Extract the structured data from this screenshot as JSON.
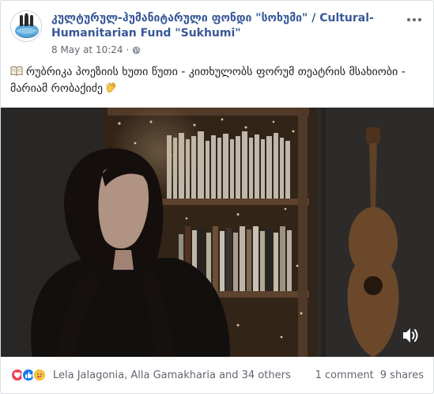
{
  "post": {
    "page_name": "კულტურულ-ჰუმანიტარული ფონდი \"სოხუმი\" / Cultural-Humanitarian Fund \"Sukhumi\"",
    "date": "8 May at 10:24",
    "separator": "·",
    "text": "რუბრიკა პოეზიის ხუთი წუთი - კითხულობს ფორუმ თეატრის მსახიობი - მარიამ რობაქიძე",
    "icons": {
      "leading": "open-book-icon",
      "trailing": "clapping-hands-icon",
      "privacy": "globe-icon",
      "sound": "speaker-icon",
      "more": "more-options-icon"
    }
  },
  "reactions": {
    "types": [
      "love",
      "like",
      "care"
    ],
    "names": "Lela Jalagonia, Alla Gamakharia and 34 others",
    "comments": "1 comment",
    "shares": "9 shares"
  },
  "colors": {
    "page_link": "#385898",
    "meta_text": "#616770",
    "love": "#f33e58",
    "like": "#1877f2",
    "care": "#f7b125"
  }
}
